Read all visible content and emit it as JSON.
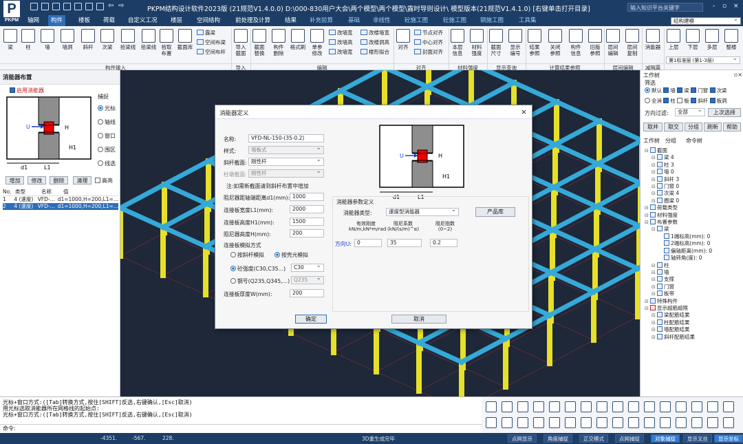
{
  "app": {
    "logo_letter": "P",
    "logo_text": "PKPM",
    "title": "PKPM结构设计软件2023版 (21规范V1.4.0.0) D:\\000-830用户大会\\两个模型\\两个模型\\露时导则设计\\ 模型版本(21规范V1.4.1.0) [右键单击打开目录]",
    "search_placeholder": "输入知识平台关键字",
    "window_controls": [
      "‐",
      "▫",
      "×"
    ]
  },
  "menu": {
    "tabs": [
      "轴网",
      "构件",
      "楼板",
      "荷载",
      "自定义工况",
      "楼层",
      "空间结构",
      "前处理及计算",
      "结果",
      "补充验算",
      "基础",
      "非线性",
      "砼施工图",
      "砼施工图",
      "钢施工图",
      "工具集"
    ],
    "active_index": 1,
    "mode_select": "结构建模"
  },
  "ribbon": {
    "big_buttons": [
      "梁",
      "柱",
      "墙",
      "墙洞",
      "斜杆",
      "次梁",
      "拾梁线",
      "拾梁线",
      "拾取布置",
      "截面库",
      "导入截面",
      "截面替换",
      "构件删除",
      "格式刷",
      "单参修改",
      "本层信息",
      "材料强度",
      "截面尺寸",
      "显示编号",
      "结果参照",
      "关闭参照",
      "构件信息",
      "旧版参照",
      "层间编辑",
      "层间复制",
      "消能器",
      "上层",
      "下层",
      "多层",
      "整楼"
    ],
    "small_buttons": [
      "露梁",
      "空间布梁",
      "空间布杆",
      "改墙宽",
      "改墙高",
      "改墙宽",
      "改楼墙宽",
      "改楼洞高",
      "楼形拟合",
      "节点对齐",
      "中心对齐",
      "封面对齐"
    ],
    "groups": [
      "构件输入",
      "导入",
      "编辑",
      "对齐",
      "材料强度",
      "显示查询",
      "计算结果参照",
      "层间编辑",
      "减隔震"
    ],
    "floor_select": "第1标准层 (第1-3层)"
  },
  "left_panel": {
    "title": "消能器布置",
    "enable_label": "启用消能器",
    "capture_title": "捕捉",
    "capture_options": [
      "光标",
      "轴线",
      "窗口",
      "围区",
      "线选"
    ],
    "diagram": {
      "u": "U",
      "h": "H",
      "h1": "H1",
      "d1": "d1",
      "l1": "L1"
    },
    "buttons": [
      "增加",
      "修改",
      "删除",
      "清理"
    ],
    "highlight_label": "高亮",
    "table": {
      "headers": [
        "No.",
        "类型",
        "名称",
        "值"
      ],
      "rows": [
        [
          "1",
          "4 (速度)",
          "VFD-...",
          "d1=1000,H=200,L1=..."
        ],
        [
          "2",
          "4 (速度)",
          "VFD-...",
          "d1=1000,H=200,L1=..."
        ]
      ]
    }
  },
  "dialog": {
    "title": "消能器定义",
    "close": "×",
    "name_label": "名称:",
    "name_value": "VFD-NL-150-(35-0.2)",
    "style_label": "样式:",
    "style_value": "墙板式",
    "brace_section_label": "斜杆截面:",
    "brace_section_value": "刚性杆",
    "column_section_label": "柱墩截面:",
    "column_section_value": "刚性杆",
    "note": "注:如需新截面请到斜杆布置中增加",
    "d1_label": "阻尼器距轴端距离d1(mm):",
    "d1_value": "1000",
    "l1_label": "连接板宽度L1(mm):",
    "l1_value": "2000",
    "h1_label": "连接板高度H1(mm):",
    "h1_value": "1500",
    "h_label": "阻尼器高度H(mm):",
    "h_value": "200",
    "sim_label": "连接板模拟方式",
    "sim_opt1": "按斜杆模拟",
    "sim_opt2": "按壳元模拟",
    "concrete_label": "砼强度(C30,C35...)",
    "concrete_value": "C30",
    "steel_label": "钢号(Q235,Q345,...)",
    "steel_value": "Q235",
    "thickness_label": "连接板厚度W(mm):",
    "thickness_value": "200",
    "params_title": "消能器参数定义",
    "damper_type_label": "消能器类型:",
    "damper_type_value": "速度型消能器",
    "library_button": "产品库",
    "col1": "有效刚度\nkN/m,kN*m/rad",
    "col2": "阻尼系数\n(kN/(s/m)^α)",
    "col3": "阻尼指数\n(0~2)",
    "direction_label": "方向U:",
    "stiffness": "0",
    "damping": "35",
    "exponent": "0.2",
    "ok": "确定",
    "cancel": "取消",
    "diagram": {
      "u": "U",
      "h": "H",
      "h1": "H1",
      "d1": "d1",
      "l1": "L1"
    }
  },
  "right_panel": {
    "title": "工作树",
    "filter_title": "筛选",
    "filter_row1": [
      "默认",
      "墙",
      "梁",
      "门窗",
      "次梁"
    ],
    "filter_row2": [
      "全消",
      "柱",
      "板",
      "斜杆",
      "板洞"
    ],
    "direction_label": "方向过滤:",
    "direction_value": "全部",
    "last_select": "上次选择",
    "ops": [
      "取并",
      "取交",
      "分组",
      "刷新",
      "帮助"
    ],
    "tabs": [
      "工作树",
      "分组",
      "命令树"
    ],
    "tree": [
      {
        "level": 0,
        "text": "截面",
        "icon": "section"
      },
      {
        "level": 1,
        "text": "梁 4",
        "icon": "beam"
      },
      {
        "level": 1,
        "text": "柱 3",
        "icon": "col"
      },
      {
        "level": 1,
        "text": "墙 0",
        "icon": "wall"
      },
      {
        "level": 1,
        "text": "斜杆 3",
        "icon": "brace"
      },
      {
        "level": 1,
        "text": "门窗 0",
        "icon": "door"
      },
      {
        "level": 1,
        "text": "次梁 4",
        "icon": "beam"
      },
      {
        "level": 1,
        "text": "圈梁 0",
        "icon": "beam"
      },
      {
        "level": 0,
        "text": "荷载类型",
        "icon": "load"
      },
      {
        "level": 0,
        "text": "材料强度",
        "icon": "mat"
      },
      {
        "level": 0,
        "text": "布置参数",
        "icon": "param"
      },
      {
        "level": 1,
        "text": "梁",
        "icon": "beam"
      },
      {
        "level": 2,
        "text": "1端标高(mm): 0",
        "icon": "z"
      },
      {
        "level": 2,
        "text": "2端标高(mm): 0",
        "icon": "z"
      },
      {
        "level": 2,
        "text": "偏轴距离(mm): 0",
        "icon": "e"
      },
      {
        "level": 2,
        "text": "轴转角(度): 0",
        "icon": "a"
      },
      {
        "level": 1,
        "text": "柱",
        "icon": "col"
      },
      {
        "level": 1,
        "text": "墙",
        "icon": "wall"
      },
      {
        "level": 1,
        "text": "支撑",
        "icon": "brace"
      },
      {
        "level": 1,
        "text": "门窗",
        "icon": "door"
      },
      {
        "level": 1,
        "text": "板带",
        "icon": "slab"
      },
      {
        "level": 0,
        "text": "特殊构件",
        "icon": "special"
      },
      {
        "level": 0,
        "text": "显示超筋超限",
        "icon": "red"
      },
      {
        "level": 1,
        "text": "梁配筋结果",
        "icon": "res"
      },
      {
        "level": 1,
        "text": "柱配筋结果",
        "icon": "res"
      },
      {
        "level": 1,
        "text": "墙配筋结果",
        "icon": "res"
      },
      {
        "level": 1,
        "text": "斜杆配筋结果",
        "icon": "res"
      }
    ]
  },
  "command": {
    "lines": [
      "光标+窗口方式:([Tab]转换方式,按住[SHIFT]反选,右键确认,[Esc]取消)",
      "用光标选取消能器所在网格线的起始点:",
      "光标+窗口方式:([Tab]转换方式,按住[SHIFT]反选,右键确认,[Esc]取消)"
    ],
    "prompt": "命令:"
  },
  "status": {
    "coords": [
      "-4351.",
      "-567.",
      "228."
    ],
    "message": "3D重生成完毕",
    "buttons": [
      "点网显示",
      "角度捕捉",
      "正交模式",
      "点网捕捉",
      "对象捕捉",
      "显示叉丝",
      "显示坐标"
    ],
    "active": [
      4,
      6
    ]
  },
  "colors": {
    "beam": "#35a9d8",
    "column": "#e6e02a",
    "accent": "#2e6db8",
    "background": "#1e2838"
  }
}
